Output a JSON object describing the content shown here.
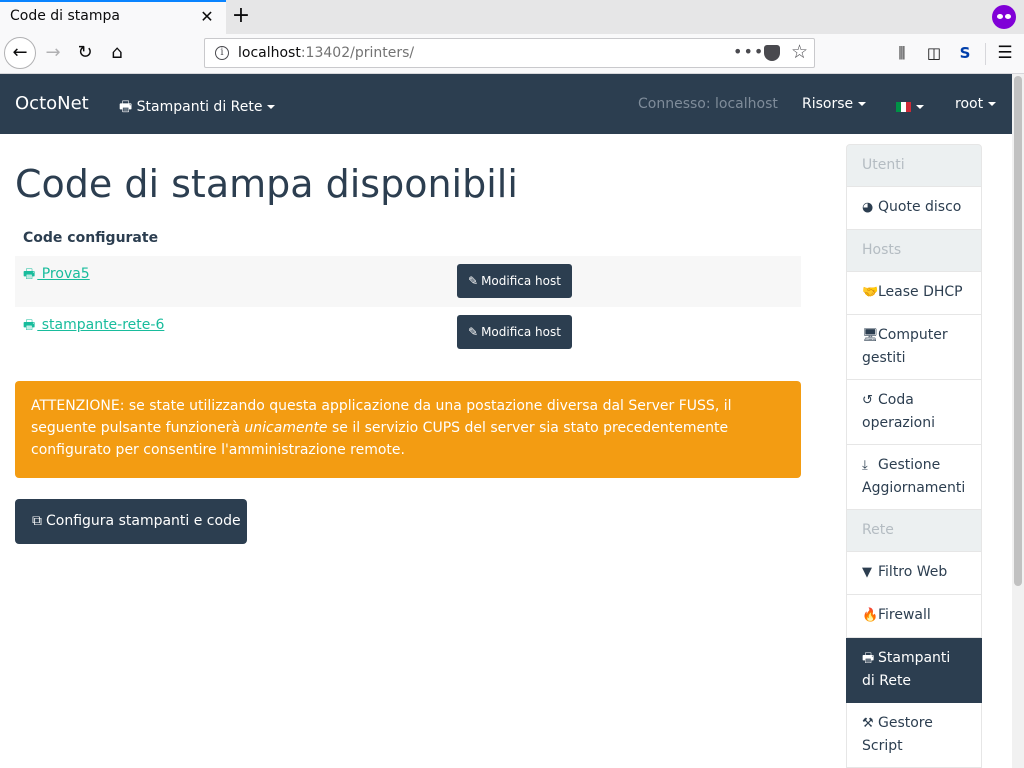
{
  "browser": {
    "tab_title": "Code di stampa",
    "tab_close": "✕",
    "new_tab": "+",
    "url_host": "localhost",
    "url_rest": ":13402/printers/",
    "url_more": "•••"
  },
  "app_navbar": {
    "brand": "OctoNet",
    "printers_menu": "Stampanti di Rete",
    "connected": "Connesso: localhost",
    "resources_menu": "Risorse",
    "user_menu": "root"
  },
  "main": {
    "title": "Code di stampa disponibili",
    "table_header": "Code configurate",
    "printers": [
      {
        "name": " Prova5",
        "action": "Modifica host"
      },
      {
        "name": " stampante-rete-6",
        "action": "Modifica host"
      }
    ],
    "alert_prefix": "ATTENZIONE: se state utilizzando questa applicazione da una postazione diversa dal Server FUSS, il seguente pulsante funzionerà ",
    "alert_emphasis": "unicamente",
    "alert_suffix": " se il servizio CUPS del server sia stato precedentemente configurato per consentire l'amministrazione remote.",
    "config_button": "Configura stampanti e code"
  },
  "sidebar": {
    "items": [
      {
        "label": "Utenti",
        "type": "header"
      },
      {
        "label": "Quote disco",
        "icon": "pie-chart-icon"
      },
      {
        "label": "Hosts",
        "type": "header"
      },
      {
        "label": "Lease DHCP",
        "icon": "handshake-icon"
      },
      {
        "label": "Computer gestiti",
        "icon": "desktop-icon"
      },
      {
        "label": "Coda operazioni",
        "icon": "history-icon"
      },
      {
        "label": "Gestione Aggiornamenti",
        "icon": "download-icon"
      },
      {
        "label": "Rete",
        "type": "header"
      },
      {
        "label": "Filtro Web",
        "icon": "filter-icon"
      },
      {
        "label": "Firewall",
        "icon": "fire-icon"
      },
      {
        "label": "Stampanti di Rete",
        "icon": "printer-icon",
        "active": true
      },
      {
        "label": "Gestore Script",
        "icon": "magic-wand-icon"
      }
    ]
  },
  "colors": {
    "navbar": "#2c3e50",
    "link": "#18bc9c",
    "alert": "#f39c12",
    "sidebar_header": "#ecf0f1"
  }
}
